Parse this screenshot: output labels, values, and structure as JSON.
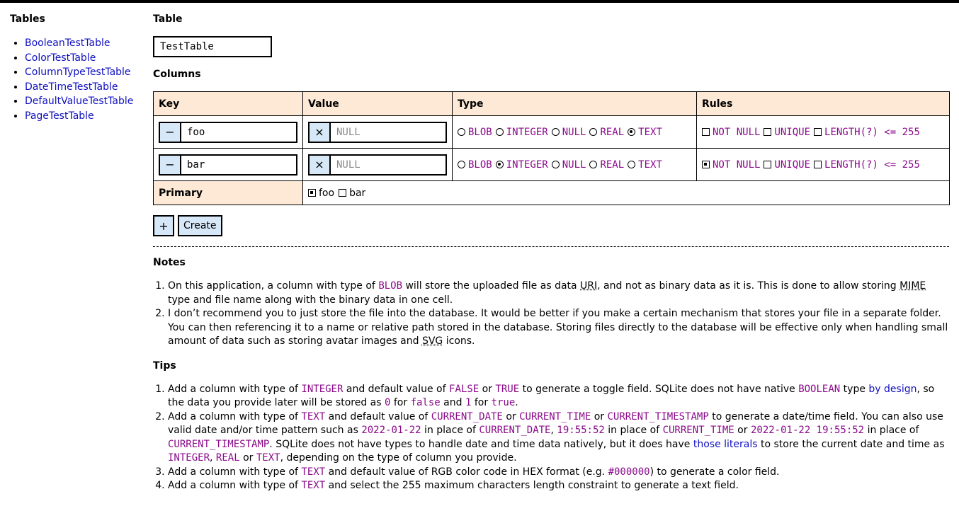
{
  "sidebar": {
    "title": "Tables",
    "items": [
      "BooleanTestTable",
      "ColorTestTable",
      "ColumnTypeTestTable",
      "DateTimeTestTable",
      "DefaultValueTestTable",
      "PageTestTable"
    ]
  },
  "table": {
    "heading": "Table",
    "name": "TestTable"
  },
  "columns": {
    "heading": "Columns",
    "headers": [
      "Key",
      "Value",
      "Type",
      "Rules"
    ],
    "remove_symbol": "−",
    "clear_symbol": "×",
    "value_placeholder": "NULL",
    "type_options": [
      "BLOB",
      "INTEGER",
      "NULL",
      "REAL",
      "TEXT"
    ],
    "rule_labels": [
      "NOT NULL",
      "UNIQUE",
      "LENGTH(?) <= 255"
    ],
    "rows": [
      {
        "key": "foo",
        "type": "TEXT",
        "not_null": false,
        "unique": false,
        "length": false
      },
      {
        "key": "bar",
        "type": "INTEGER",
        "not_null": true,
        "unique": false,
        "length": false
      }
    ],
    "primary_label": "Primary",
    "primary": [
      {
        "label": "foo",
        "checked": true
      },
      {
        "label": "bar",
        "checked": false
      }
    ]
  },
  "actions": {
    "add": "+",
    "create": "Create"
  },
  "notes": {
    "heading": "Notes",
    "n1": {
      "a": "On this application, a column with type of ",
      "code": "BLOB",
      "b": " will store the uploaded file as data ",
      "abbr1": "URI",
      "c": ", and not as binary data as it is. This is done to allow storing ",
      "abbr2": "MIME",
      "d": " type and file name along with the binary data in one cell."
    },
    "n2": {
      "a": "I don’t recommend you to just store the file into the database. It would be better if you make a certain mechanism that stores your file in a separate folder. You can then referencing it to a name or relative path stored in the database. Storing files directly to the database will be effective only when handling small amount of data such as storing avatar images and ",
      "abbr": "SVG",
      "b": " icons."
    }
  },
  "tips": {
    "heading": "Tips",
    "t1": {
      "a": "Add a column with type of ",
      "c1": "INTEGER",
      "b": " and default value of ",
      "c2": "FALSE",
      "c": " or ",
      "c3": "TRUE",
      "d": " to generate a toggle field. SQLite does not have native ",
      "c4": "BOOLEAN",
      "e": " type ",
      "link": "by design",
      "f": ", so the data you provide later will be stored as ",
      "c5": "0",
      "g": " for ",
      "c6": "false",
      "h": " and ",
      "c7": "1",
      "i": " for ",
      "c8": "true",
      "j": "."
    },
    "t2": {
      "a": "Add a column with type of ",
      "c1": "TEXT",
      "b": " and default value of ",
      "c2": "CURRENT_DATE",
      "c": " or ",
      "c3": "CURRENT_TIME",
      "d": " or ",
      "c4": "CURRENT_TIMESTAMP",
      "e": " to generate a date/time field. You can also use valid date and/or time pattern such as ",
      "c5": "2022-01-22",
      "f": " in place of ",
      "c6": "CURRENT_DATE",
      "g": ", ",
      "c7": "19:55:52",
      "h": " in place of ",
      "c8": "CURRENT_TIME",
      "i": " or ",
      "c9": "2022-01-22 19:55:52",
      "j": " in place of ",
      "c10": "CURRENT_TIMESTAMP",
      "k": ". SQLite does not have types to handle date and time data natively, but it does have ",
      "link": "those literals",
      "l": " to store the current date and time as ",
      "c11": "INTEGER",
      "m": ", ",
      "c12": "REAL",
      "n": " or ",
      "c13": "TEXT",
      "o": ", depending on the type of column you provide."
    },
    "t3": {
      "a": "Add a column with type of ",
      "c1": "TEXT",
      "b": " and default value of RGB color code in HEX format (e.g. ",
      "c2": "#000000",
      "c": ") to generate a color field."
    },
    "t4": {
      "a": "Add a column with type of ",
      "c1": "TEXT",
      "b": " and select the 255 maximum characters length constraint to generate a text field."
    }
  }
}
